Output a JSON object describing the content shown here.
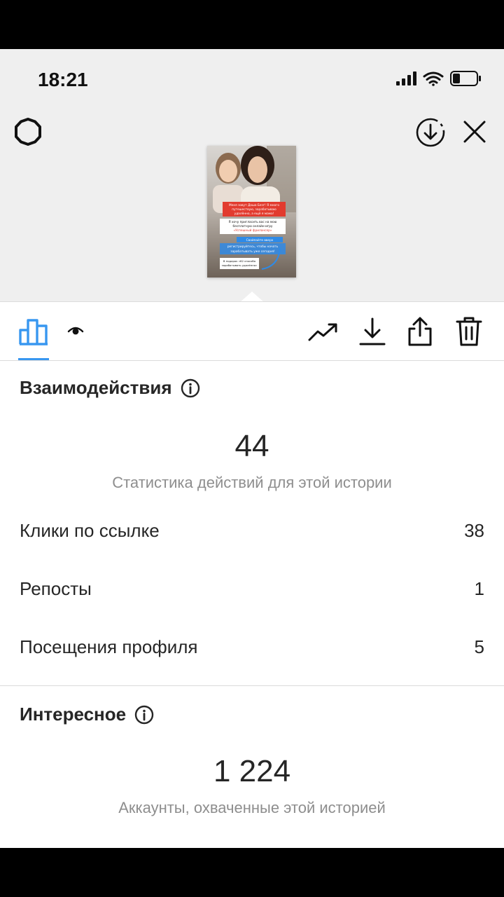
{
  "status_bar": {
    "time": "18:21"
  },
  "story_thumbnail": {
    "caption_lines": [
      "Меня зовут Даша Безг! Я много",
      "путешествую, зарабатываю",
      "удалённо, а ещё я мама!",
      "Я хочу пригласить вас на мою",
      "бесплатную онлайн-игру",
      "«Успешный фрилансер»",
      "Свайпайте вверх",
      "регистрируйтесь, чтобы начать",
      "зарабатывать уже сегодня!",
      "В подарок «62 способа",
      "зарабатывать удалённо»"
    ]
  },
  "interactions": {
    "title": "Взаимодействия",
    "total": "44",
    "subtitle": "Статистика действий для этой истории",
    "rows": [
      {
        "label": "Клики по ссылке",
        "value": "38"
      },
      {
        "label": "Репосты",
        "value": "1"
      },
      {
        "label": "Посещения профиля",
        "value": "5"
      }
    ]
  },
  "discovery": {
    "title": "Интересное",
    "total": "1 224",
    "subtitle": "Аккаунты, охваченные этой историей"
  },
  "colors": {
    "accent": "#3897f0",
    "muted": "#8e8e8e",
    "text": "#262626"
  }
}
